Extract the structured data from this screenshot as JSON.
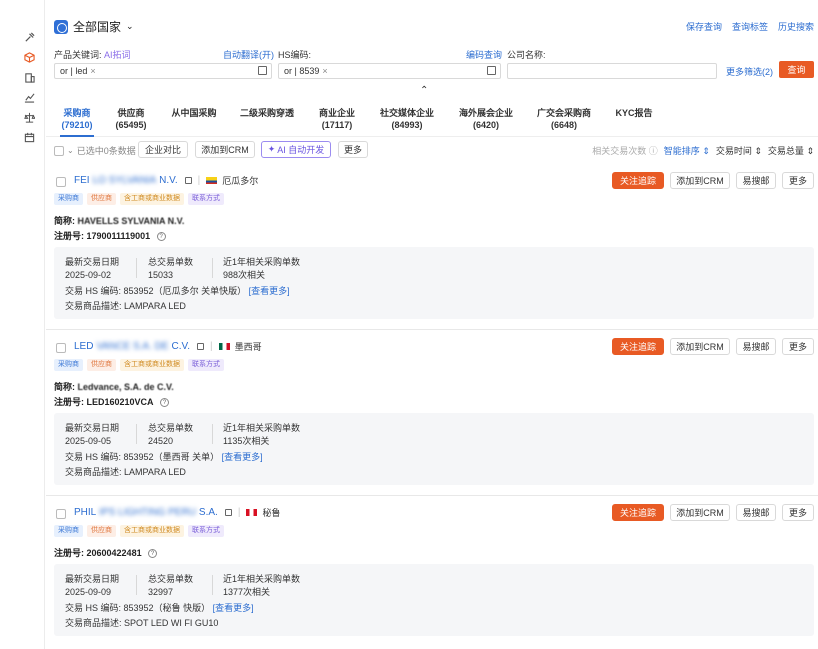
{
  "sidebar": {
    "icons": [
      "tools-icon",
      "cube-icon",
      "building-icon",
      "chart-icon",
      "scale-icon",
      "calendar-icon"
    ]
  },
  "header": {
    "country": "全部国家",
    "links": [
      "保存查询",
      "查询标签",
      "历史搜索"
    ]
  },
  "filters": {
    "keyword_label": "产品关键词:",
    "ai_expand": "AI拓词",
    "auto_translate": "自动翻译(开)",
    "hs_label": "HS编码:",
    "hs_lookup": "编码查询",
    "company_label": "公司名称:",
    "keyword_value": "or | led",
    "hs_value": "or | 8539",
    "company_value": "",
    "more_filters": "更多筛选(2)",
    "query_button": "查询"
  },
  "tabs": [
    {
      "label": "采购商",
      "count": "(79210)"
    },
    {
      "label": "供应商",
      "count": "(65495)"
    },
    {
      "label": "从中国采购",
      "count": ""
    },
    {
      "label": "二级采购穿透",
      "count": ""
    },
    {
      "label": "商业企业",
      "count": "(17117)"
    },
    {
      "label": "社交媒体企业",
      "count": "(84993)"
    },
    {
      "label": "海外展会企业",
      "count": "(6420)"
    },
    {
      "label": "广交会采购商",
      "count": "(6648)"
    },
    {
      "label": "KYC报告",
      "count": ""
    }
  ],
  "toolbar": {
    "selected": "已选中0条数据",
    "compare": "企业对比",
    "add_crm": "添加到CRM",
    "ai_dev": "AI 自动开发",
    "more": "更多",
    "related_count": "相关交易次数",
    "smart_sort": "智能排序",
    "trade_time": "交易时间",
    "trade_total": "交易总量"
  },
  "card_labels": {
    "follow": "关注追踪",
    "add_crm": "添加到CRM",
    "search_mail": "易搜邮",
    "more": "更多",
    "short_name": "简称:",
    "reg_no": "注册号:",
    "latest_date": "最新交易日期",
    "total_orders": "总交易单数",
    "year_orders": "近1年相关采购单数",
    "hs_prefix": "交易 HS 编码:",
    "desc_prefix": "交易商品描述:",
    "view_more": "[查看更多]"
  },
  "companies": [
    {
      "name_visible": "FEI",
      "name_blurred": "LO SYLVANIA",
      "name_tail": "N.V.",
      "country": "厄瓜多尔",
      "tags": [
        "采购商",
        "供应商",
        "含工商或商业数据",
        "联系方式"
      ],
      "short_name": "HAVELLS SYLVANIA N.V.",
      "reg_no": "1790011119001",
      "latest_date": "2025-09-02",
      "total_orders": "15033",
      "year_orders": "988次相关",
      "hs": "853952（厄瓜多尔 关单快版）",
      "desc": "LAMPARA LED"
    },
    {
      "name_visible": "LED",
      "name_blurred": "VANCE S.A. DE",
      "name_tail": "C.V.",
      "country": "墨西哥",
      "tags": [
        "采购商",
        "供应商",
        "含工商或商业数据",
        "联系方式"
      ],
      "short_name": "Ledvance, S.A. de C.V.",
      "reg_no": "LED160210VCA",
      "latest_date": "2025-09-05",
      "total_orders": "24520",
      "year_orders": "1135次相关",
      "hs": "853952（墨西哥 关单）",
      "desc": "LAMPARA LED"
    },
    {
      "name_visible": "PHIL",
      "name_blurred": "IPS LIGHTING PERU",
      "name_tail": "S.A.",
      "country": "秘鲁",
      "tags": [
        "采购商",
        "供应商",
        "含工商或商业数据",
        "联系方式"
      ],
      "short_name": "",
      "reg_no": "20600422481",
      "latest_date": "2025-09-09",
      "total_orders": "32997",
      "year_orders": "1377次相关",
      "hs": "853952（秘鲁 快版）",
      "desc": "SPOT LED WI FI GU10"
    }
  ],
  "colors": {
    "accent_orange": "#e85a24",
    "link_blue": "#2c6dd0",
    "ai_purple": "#6a55e0"
  }
}
